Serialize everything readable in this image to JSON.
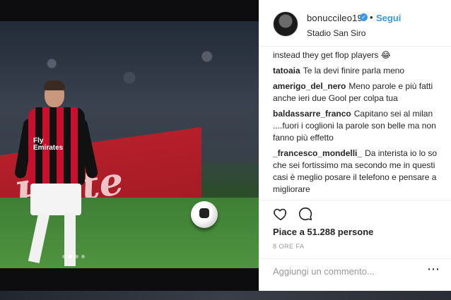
{
  "post": {
    "username": "bonuccileo19",
    "verified_glyph": "✓",
    "separator": "•",
    "follow_label": "Segui",
    "location": "Stadio San Siro"
  },
  "photo": {
    "board_text": "Plete",
    "shirt_text": "Fly\nEmirates",
    "carousel_count": 4,
    "carousel_active": 1
  },
  "comments": [
    {
      "user": "",
      "text": "instead they get flop players 😂"
    },
    {
      "user": "tatoaia",
      "text": "Te la devi finire parla meno"
    },
    {
      "user": "amerigo_del_nero",
      "text": "Meno parole e più fatti anche ieri due Gool per colpa tua"
    },
    {
      "user": "baldassarre_franco",
      "text": "Capitano sei al milan ....fuori i coglioni la parole son belle ma non fanno più effetto"
    },
    {
      "user": "_francesco_mondelli_",
      "text": "Da interista io lo so che sei fortissimo ma secondo me in questi casi è meglio posare il telefono e pensare a migliorare"
    }
  ],
  "actions": {
    "like_icon": "heart-icon",
    "comment_icon": "comment-icon",
    "likes_text": "Piace a 51.288 persone",
    "time_text": "8 ORE FA",
    "comment_placeholder": "Aggiungi un commento...",
    "more_glyph": "⋯"
  },
  "colors": {
    "accent": "#3897f0",
    "text": "#262626",
    "muted": "#999999"
  }
}
